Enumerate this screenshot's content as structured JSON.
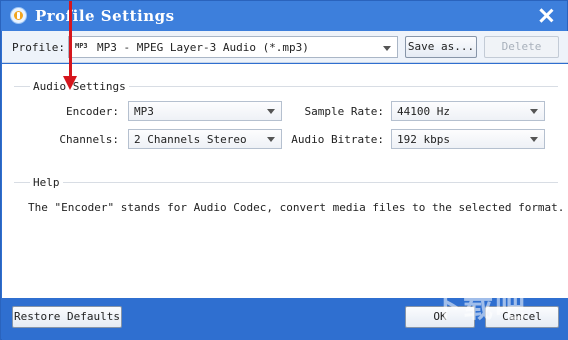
{
  "window": {
    "title": "Profile Settings",
    "icon": "app-icon",
    "close_icon": "close-icon"
  },
  "profile": {
    "label": "Profile:",
    "selected": "MP3 - MPEG Layer-3 Audio (*.mp3)",
    "format_icon_text": "MP3",
    "save_as_label": "Save as...",
    "delete_label": "Delete"
  },
  "audio_settings": {
    "title": "Audio Settings",
    "encoder": {
      "label": "Encoder:",
      "value": "MP3"
    },
    "sample_rate": {
      "label": "Sample Rate:",
      "value": "44100 Hz"
    },
    "channels": {
      "label": "Channels:",
      "value": "2 Channels Stereo"
    },
    "audio_bitrate": {
      "label": "Audio Bitrate:",
      "value": "192 kbps"
    }
  },
  "help": {
    "title": "Help",
    "text": "The \"Encoder\" stands for Audio Codec, convert media files to the selected format."
  },
  "footer": {
    "restore_label": "Restore Defaults",
    "ok_label": "OK",
    "cancel_label": "Cancel"
  },
  "colors": {
    "title_bar": "#3d7fdc",
    "frame": "#2f6fd0",
    "annotation_arrow": "#d6161d"
  }
}
